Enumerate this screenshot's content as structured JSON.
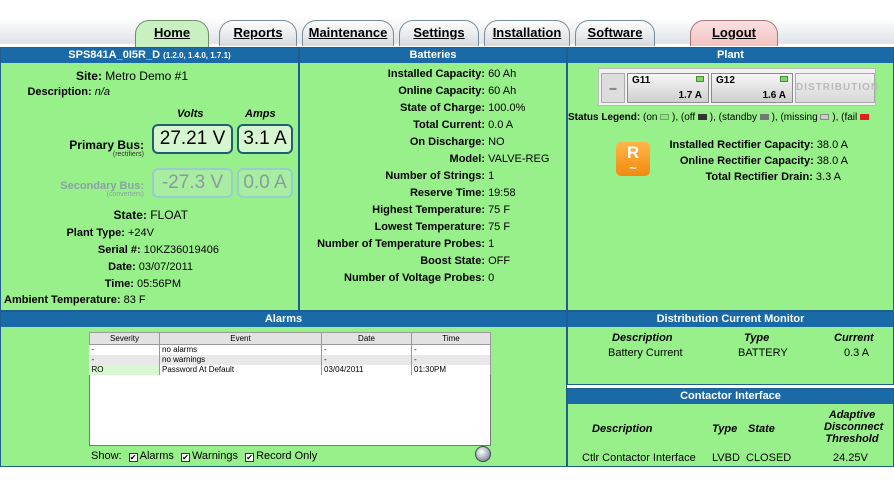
{
  "tabs": [
    {
      "label": "Home",
      "active": true
    },
    {
      "label": "Reports"
    },
    {
      "label": "Maintenance"
    },
    {
      "label": "Settings"
    },
    {
      "label": "Installation"
    },
    {
      "label": "Software"
    },
    {
      "label": "Logout"
    }
  ],
  "system": {
    "title": "SPS841A_0I5R_D",
    "version": "(1.2.0, 1.4.0, 1.7.1)",
    "site_label": "Site:",
    "site": "Metro Demo #1",
    "description_label": "Description:",
    "description": "n/a",
    "volts_label": "Volts",
    "amps_label": "Amps",
    "primary_bus_label": "Primary Bus:",
    "primary_bus_sub": "(rectifiers)",
    "primary_volts": "27.21 V",
    "primary_amps": "3.1 A",
    "secondary_bus_label": "Secondary Bus:",
    "secondary_bus_sub": "(converters)",
    "secondary_volts": "-27.3 V",
    "secondary_amps": "0.0 A",
    "state_label": "State:",
    "state": "FLOAT",
    "plant_type_label": "Plant Type:",
    "plant_type": "+24V",
    "serial_label": "Serial #:",
    "serial": "10KZ36019406",
    "date_label": "Date:",
    "date": "03/07/2011",
    "time_label": "Time:",
    "time": "05:56PM",
    "ambient_label": "Ambient Temperature:",
    "ambient": "83 F"
  },
  "batteries": {
    "title": "Batteries",
    "rows": [
      {
        "label": "Installed Capacity:",
        "value": "60 Ah"
      },
      {
        "label": "Online Capacity:",
        "value": "60 Ah"
      },
      {
        "label": "State of Charge:",
        "value": "100.0%"
      },
      {
        "label": "Total Current:",
        "value": "0.0 A"
      },
      {
        "label": "On Discharge:",
        "value": "NO"
      },
      {
        "label": "Model:",
        "value": "VALVE-REG"
      },
      {
        "label": "Number of Strings:",
        "value": "1"
      },
      {
        "label": "Reserve Time:",
        "value": "19:58"
      },
      {
        "label": "Highest Temperature:",
        "value": "75 F"
      },
      {
        "label": "Lowest Temperature:",
        "value": "75 F"
      },
      {
        "label": "Number of Temperature Probes:",
        "value": "1"
      },
      {
        "label": "Boost State:",
        "value": "OFF"
      },
      {
        "label": "Number of Voltage Probes:",
        "value": "0"
      }
    ]
  },
  "plant": {
    "title": "Plant",
    "modules": [
      {
        "name": "G11",
        "current": "1.7 A"
      },
      {
        "name": "G12",
        "current": "1.6 A"
      }
    ],
    "distribution_label": "DISTRIBUTION",
    "legend_label": "Status Legend:",
    "legend_items": [
      "(on",
      "), (off",
      "), (standby",
      "), (missing",
      "), (fail"
    ],
    "rect_icon": "R",
    "installed_label": "Installed Rectifier Capacity:",
    "installed": "38.0 A",
    "online_label": "Online Rectifier Capacity:",
    "online": "38.0 A",
    "drain_label": "Total Rectifier Drain:",
    "drain": "3.3 A"
  },
  "alarms": {
    "title": "Alarms",
    "headers": [
      "Severity",
      "Event",
      "Date",
      "Time"
    ],
    "rows": [
      {
        "severity": "-",
        "event": "no alarms",
        "date": "-",
        "time": "-"
      },
      {
        "severity": "-",
        "event": "no warnings",
        "date": "-",
        "time": "-"
      },
      {
        "severity": "RO",
        "event": "Password At Default",
        "date": "03/04/2011",
        "time": "01:30PM"
      }
    ],
    "show_label": "Show:",
    "filters": [
      {
        "label": "Alarms",
        "checked": true
      },
      {
        "label": "Warnings",
        "checked": true
      },
      {
        "label": "Record Only",
        "checked": true
      }
    ]
  },
  "distribution": {
    "title": "Distribution Current Monitor",
    "headers": [
      "Description",
      "Type",
      "Current"
    ],
    "rows": [
      {
        "description": "Battery Current",
        "type": "BATTERY",
        "current": "0.3 A"
      }
    ]
  },
  "contactor": {
    "title": "Contactor Interface",
    "headers": [
      "Description",
      "Type",
      "State",
      "Adaptive Disconnect Threshold"
    ],
    "rows": [
      {
        "description": "Ctlr Contactor Interface",
        "type": "LVBD",
        "state": "CLOSED",
        "threshold": "24.25V"
      }
    ]
  },
  "colors": {
    "header_blue": "#1a6aa8",
    "panel_green": "#98f08a",
    "primary_box": "#d6f6d0",
    "rect_orange": "#f28a10"
  }
}
